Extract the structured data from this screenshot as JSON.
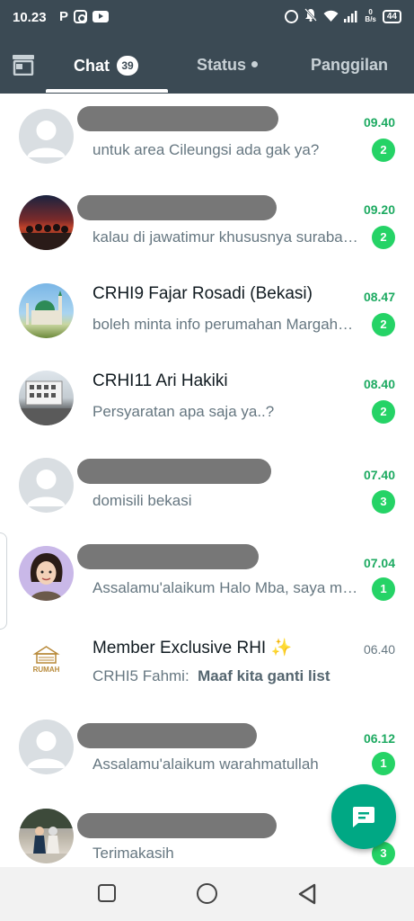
{
  "status_bar": {
    "time": "10.23",
    "p_icon": "P",
    "speed_top": "0",
    "speed_unit": "B/s",
    "battery": "44"
  },
  "tabs": {
    "chat_label": "Chat",
    "chat_badge": "39",
    "status_label": "Status",
    "calls_label": "Panggilan"
  },
  "chats": [
    {
      "name": "",
      "message": "untuk area Cileungsi ada gak ya?",
      "time": "09.40",
      "unread": "2",
      "avatar": "default-avatar"
    },
    {
      "name": "",
      "message": "kalau di jawatimur khususnya surabaya",
      "time": "09.20",
      "unread": "2",
      "avatar": "photo-avatar"
    },
    {
      "name": "CRHI9 Fajar Rosadi (Bekasi)",
      "message": "boleh minta info perumahan Margahayu",
      "time": "08.47",
      "unread": "2",
      "avatar": "mosque-avatar"
    },
    {
      "name": "CRHI11 Ari Hakiki",
      "message": "Persyaratan apa saja ya..?",
      "time": "08.40",
      "unread": "2",
      "avatar": "building-avatar"
    },
    {
      "name": "",
      "message": "domisili bekasi",
      "time": "07.40",
      "unread": "3",
      "avatar": "default-avatar"
    },
    {
      "name": "",
      "message": "Assalamu'alaikum Halo Mba, saya mau tanya",
      "time": "07.04",
      "unread": "1",
      "avatar": "woman-avatar"
    },
    {
      "name": "Member Exclusive RHI ✨",
      "message_sender": "CRHI5 Fahmi:",
      "message": "Maaf kita ganti list",
      "time": "06.40",
      "unread": "",
      "avatar": "rumah-logo"
    },
    {
      "name": "",
      "message": "Assalamu'alaikum warahmatullah",
      "time": "06.12",
      "unread": "1",
      "avatar": "default-avatar"
    },
    {
      "name": "",
      "message": "Terimakasih",
      "time": "",
      "unread": "3",
      "avatar": "couple-avatar"
    }
  ],
  "logo_text": "RUMAH",
  "colors": {
    "header": "#3b4a54",
    "accent_green": "#1daa61",
    "badge_green": "#25d366",
    "fab": "#00a884"
  }
}
